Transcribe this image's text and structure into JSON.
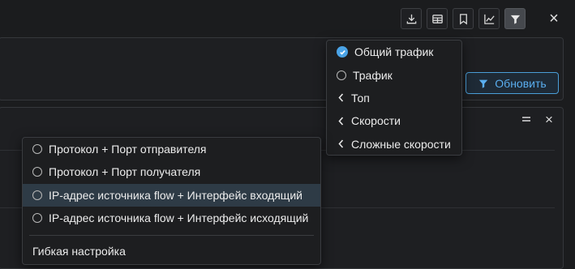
{
  "toolbar": {
    "buttons": [
      {
        "name": "download-icon"
      },
      {
        "name": "table-icon"
      },
      {
        "name": "bookmark-icon"
      },
      {
        "name": "line-chart-icon"
      },
      {
        "name": "filter-icon",
        "active": true
      }
    ],
    "close": "×"
  },
  "refresh_button": {
    "label": "Обновить"
  },
  "panel_header_icons": {
    "collapse": "═",
    "close": "×"
  },
  "traffic_menu": {
    "items": [
      {
        "label": "Общий трафик",
        "state": "checked"
      },
      {
        "label": "Трафик",
        "state": "radio"
      },
      {
        "label": "Топ",
        "state": "submenu"
      },
      {
        "label": "Скорости",
        "state": "submenu"
      },
      {
        "label": "Сложные скорости",
        "state": "submenu"
      }
    ]
  },
  "group_menu": {
    "items": [
      {
        "label": "Протокол + Порт отправителя"
      },
      {
        "label": "Протокол + Порт получателя"
      },
      {
        "label": "IP-адрес источника flow + Интерфейс входящий",
        "hover": true
      },
      {
        "label": "IP-адрес источника flow + Интерфейс исходящий"
      }
    ],
    "footer": "Гибкая настройка"
  },
  "colors": {
    "background": "#1b1c1e",
    "accent": "#4aa3e6",
    "hover": "#2e3b46"
  }
}
